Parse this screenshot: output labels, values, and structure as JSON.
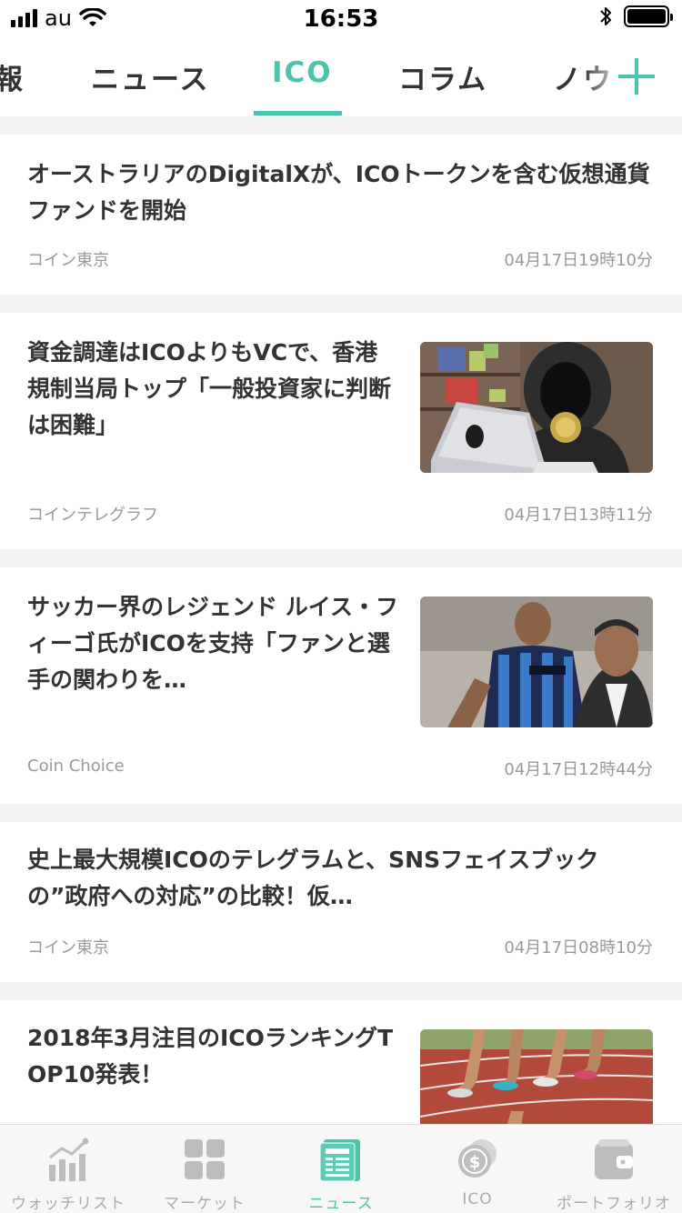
{
  "status_bar": {
    "carrier": "au",
    "time": "16:53"
  },
  "tabs": [
    {
      "label": "報"
    },
    {
      "label": "ニュース"
    },
    {
      "label": "ICO"
    },
    {
      "label": "コラム"
    },
    {
      "label": "ノウ"
    }
  ],
  "active_tab": "ICO",
  "articles": [
    {
      "title": "オーストラリアのDigitalXが、ICOトークンを含む仮想通貨ファンドを開始",
      "source": "コイン東京",
      "date": "04月17日19時10分",
      "has_image": false
    },
    {
      "title": "資金調達はICOよりもVCで、香港規制当局トップ「一般投資家に判断は困難」",
      "source": "コインテレグラフ",
      "date": "04月17日13時11分",
      "has_image": true,
      "image": "hooded-hacker-laptop-illustration"
    },
    {
      "title": "サッカー界のレジェンド ルイス・フィーゴ氏がICOを支持「ファンと選手の関わりを…",
      "source": "Coin Choice",
      "date": "04月17日12時44分",
      "has_image": true,
      "image": "football-player-photo"
    },
    {
      "title": "史上最大規模ICOのテレグラムと、SNSフェイスブックの”政府への対応”の比較！仮…",
      "source": "コイン東京",
      "date": "04月17日08時10分",
      "has_image": false
    },
    {
      "title": "2018年3月注目のICOランキングTOP10発表！",
      "has_image": true,
      "image": "running-track-photo"
    }
  ],
  "bottom_nav": [
    {
      "label": "ウォッチリスト",
      "icon": "chart-icon"
    },
    {
      "label": "マーケット",
      "icon": "grid-icon"
    },
    {
      "label": "ニュース",
      "icon": "newspaper-icon"
    },
    {
      "label": "ICO",
      "icon": "coins-icon"
    },
    {
      "label": "ポートフォリオ",
      "icon": "wallet-icon"
    }
  ],
  "colors": {
    "accent": "#4dc3ad",
    "inactive": "#aaaaaa",
    "separator": "#f2f2f2"
  }
}
